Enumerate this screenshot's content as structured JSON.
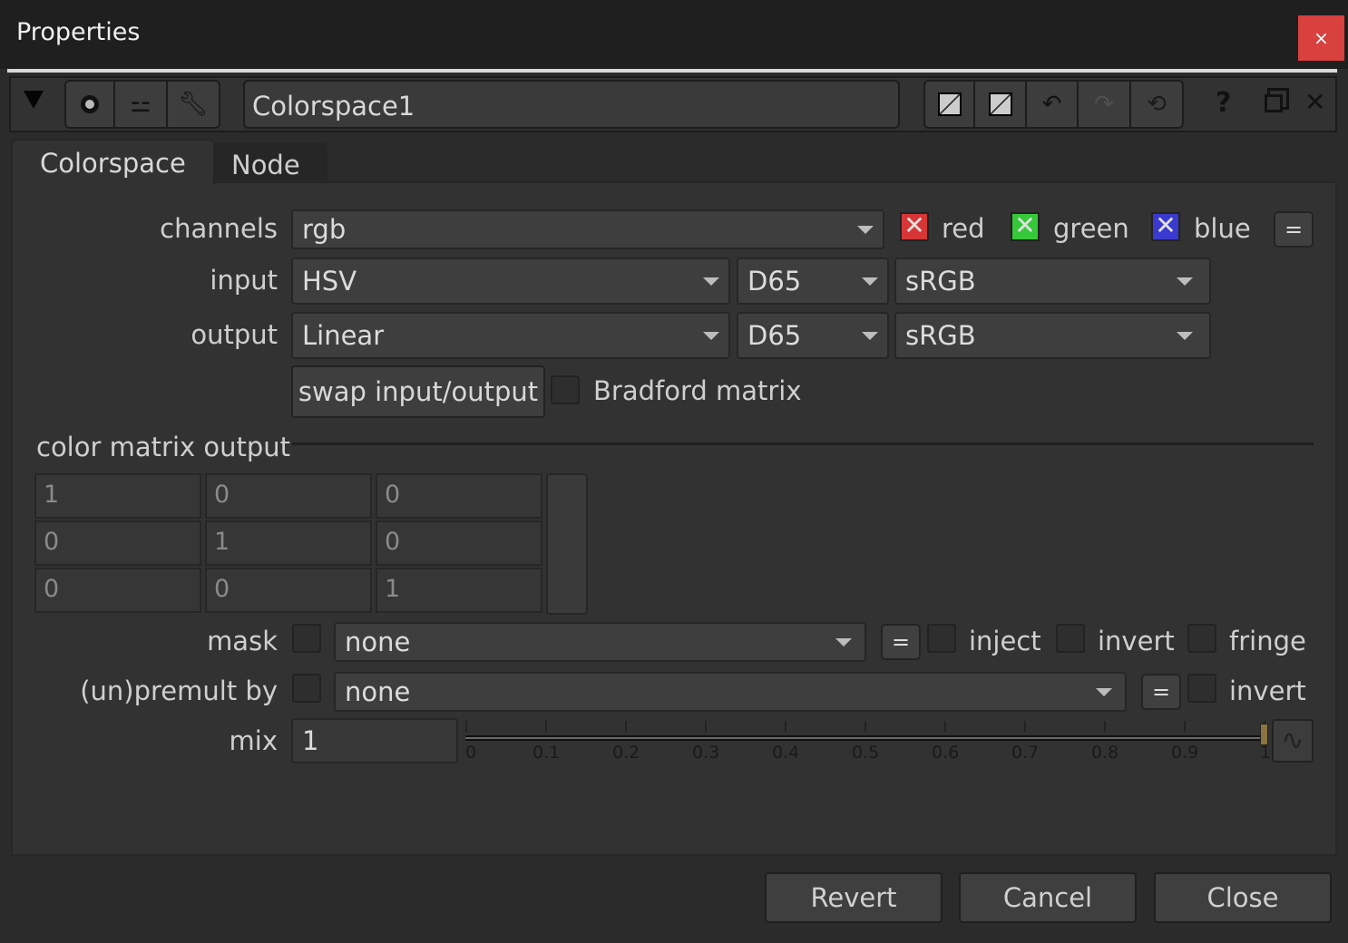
{
  "window": {
    "title": "Properties",
    "close": "×"
  },
  "toolbar": {
    "node_name": "Colorspace1",
    "icons": [
      "collapse-triangle-icon",
      "viewer-circle-icon",
      "bug-icon",
      "wrench-icon",
      "swatch-icon",
      "swatch-icon",
      "undo-icon",
      "redo-icon",
      "revert-icon",
      "help-icon",
      "float-icon",
      "close-icon"
    ],
    "help": "?",
    "close": "✕"
  },
  "tabs": [
    {
      "label": "Colorspace",
      "active": true
    },
    {
      "label": "Node",
      "active": false
    }
  ],
  "channels": {
    "label": "channels",
    "value": "rgb",
    "red": "red",
    "green": "green",
    "blue": "blue",
    "red_color": "#d83636",
    "green_color": "#35c838",
    "blue_color": "#3a3ad0",
    "eq": "="
  },
  "input": {
    "label": "input",
    "space": "HSV",
    "illuminant": "D65",
    "primaries": "sRGB"
  },
  "output": {
    "label": "output",
    "space": "Linear",
    "illuminant": "D65",
    "primaries": "sRGB"
  },
  "swap_label": "swap input/output",
  "bradford": {
    "label": "Bradford matrix",
    "checked": false
  },
  "matrix": {
    "label": "color matrix output",
    "values": [
      [
        "1",
        "0",
        "0"
      ],
      [
        "0",
        "1",
        "0"
      ],
      [
        "0",
        "0",
        "1"
      ]
    ]
  },
  "mask": {
    "label": "mask",
    "value": "none",
    "eq": "=",
    "inject": "inject",
    "invert": "invert",
    "fringe": "fringe"
  },
  "premult": {
    "label": "(un)premult by",
    "value": "none",
    "eq": "=",
    "invert": "invert"
  },
  "mix": {
    "label": "mix",
    "value": "1",
    "slider_value": 1,
    "ticks": [
      "0",
      "0.1",
      "0.2",
      "0.3",
      "0.4",
      "0.5",
      "0.6",
      "0.7",
      "0.8",
      "0.9",
      "1"
    ]
  },
  "buttons": {
    "revert": "Revert",
    "cancel": "Cancel",
    "close": "Close"
  }
}
